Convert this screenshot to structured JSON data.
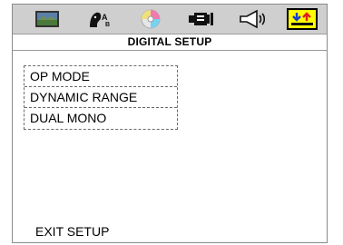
{
  "toolbar": {
    "icons": [
      {
        "name": "tv-screen-icon"
      },
      {
        "name": "language-icon"
      },
      {
        "name": "disc-icon"
      },
      {
        "name": "video-connector-icon"
      },
      {
        "name": "speaker-icon"
      },
      {
        "name": "digital-setup-icon",
        "selected": true
      }
    ]
  },
  "page": {
    "title": "DIGITAL SETUP"
  },
  "menu": {
    "items": [
      {
        "label": "OP MODE"
      },
      {
        "label": "DYNAMIC RANGE"
      },
      {
        "label": "DUAL MONO"
      }
    ]
  },
  "footer": {
    "exit_label": "EXIT SETUP"
  },
  "colors": {
    "toolbar_bg": "#cfcfcf",
    "selected_tab_bg": "#ffff00",
    "text": "#000000"
  }
}
